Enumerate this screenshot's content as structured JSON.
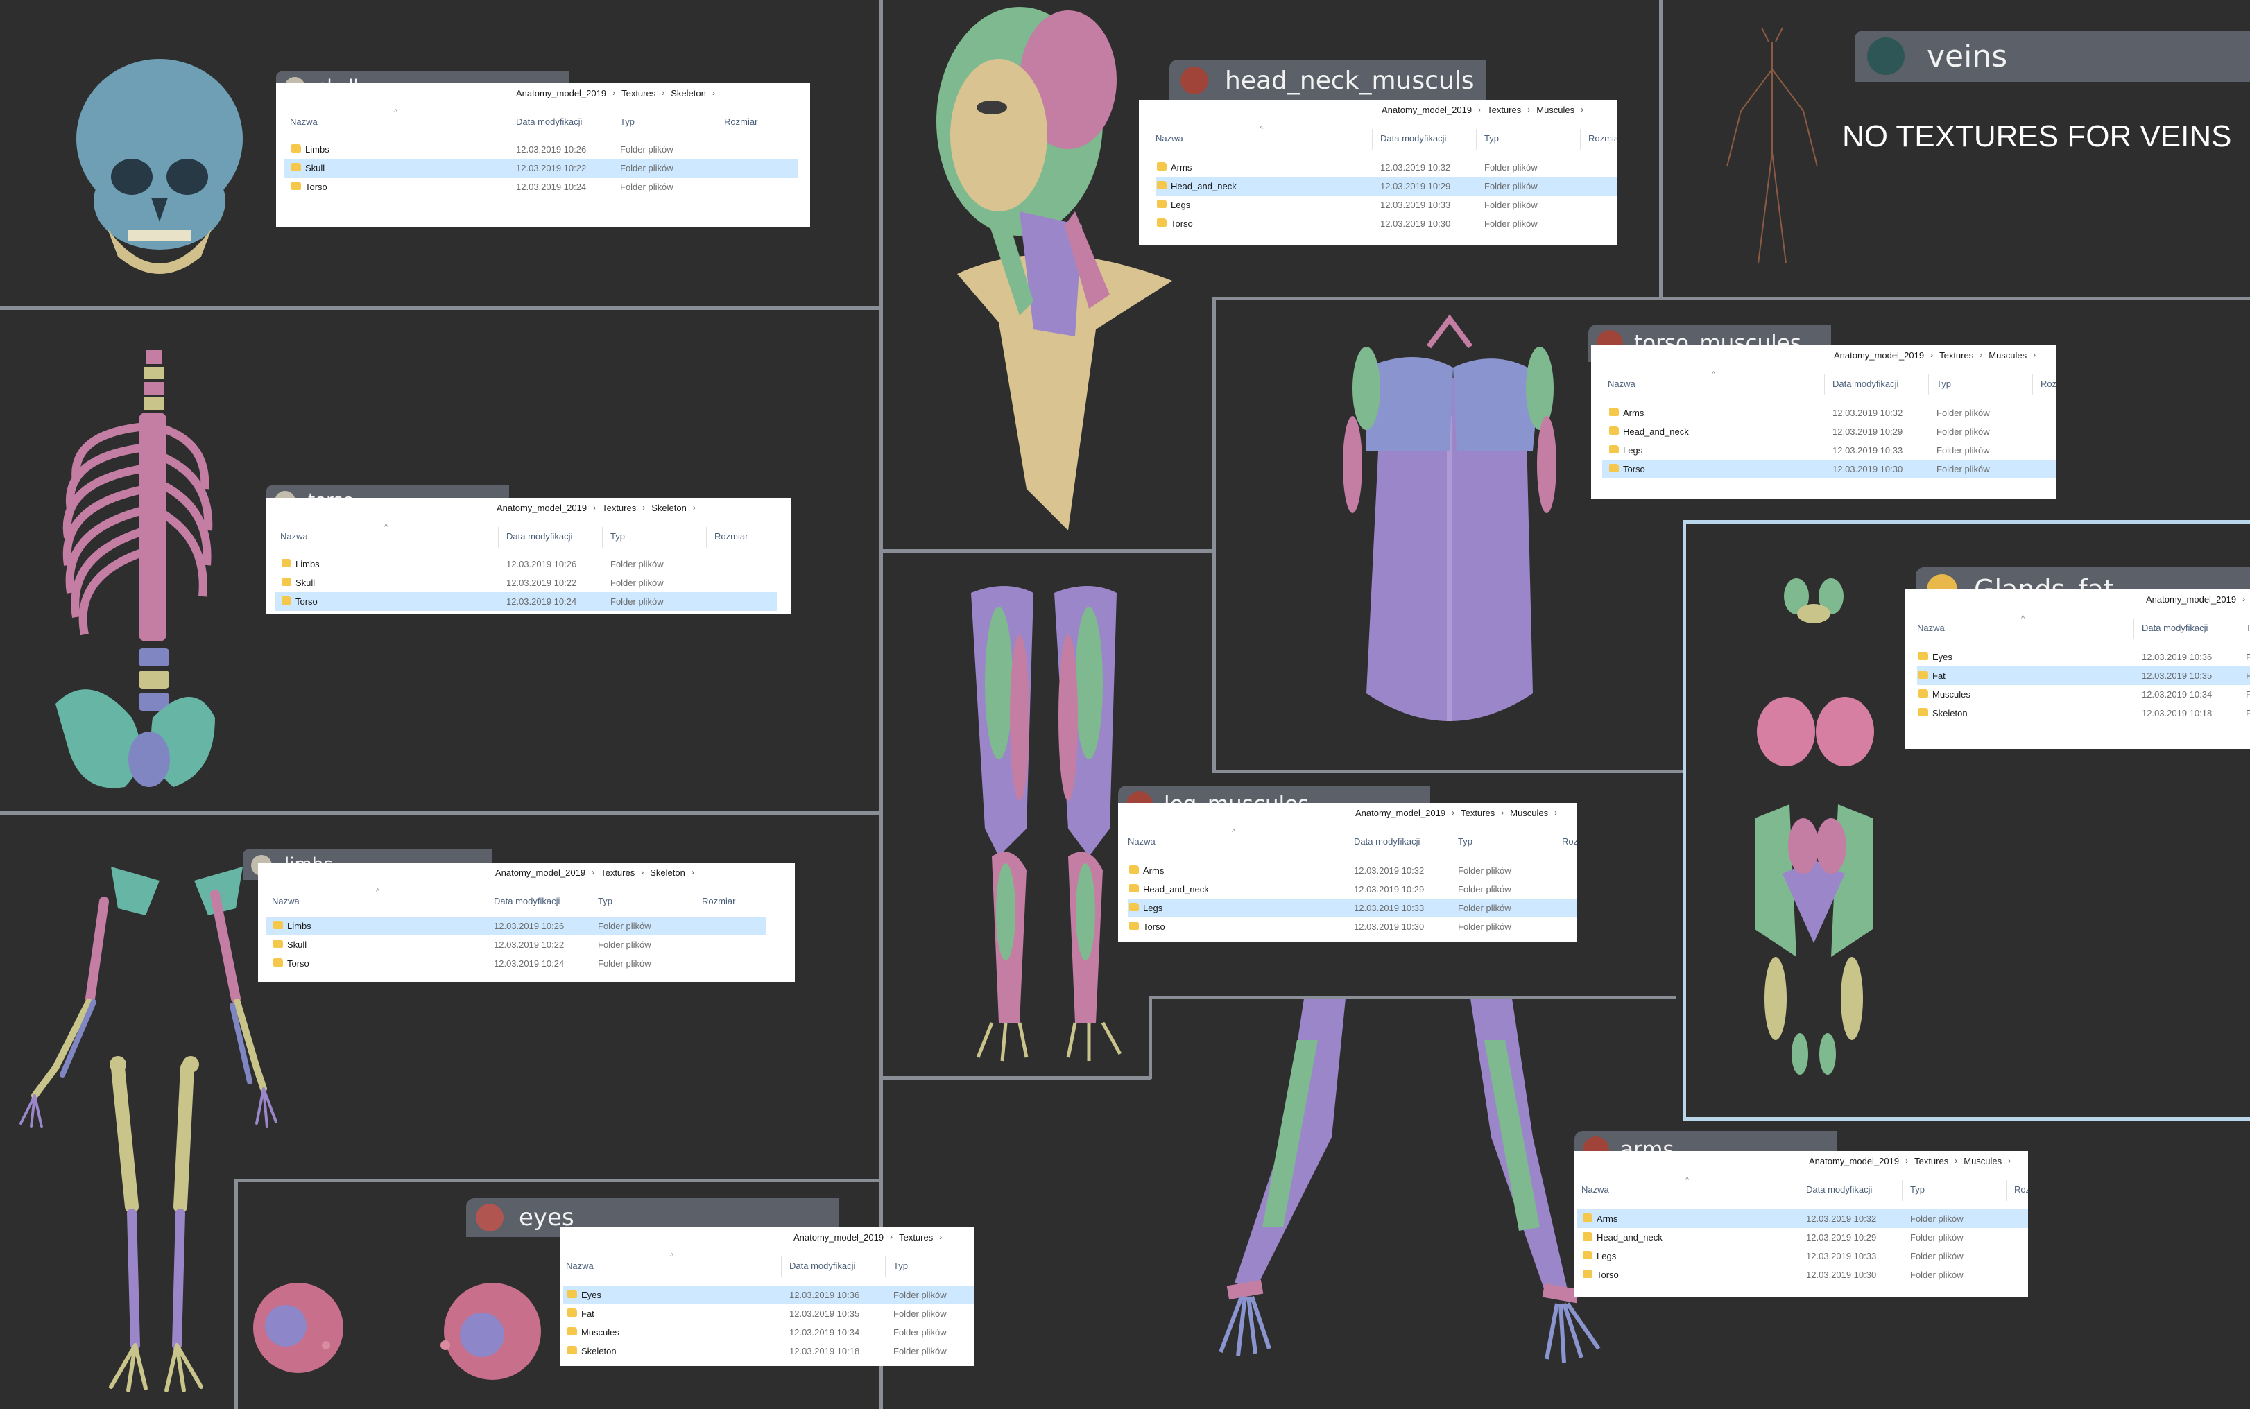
{
  "colors": {
    "background": "#2e2e2f",
    "divider": "#8a8e96",
    "selection": "#cde8ff",
    "muscle_purple": "#9b86c9",
    "muscle_green": "#7fb98f",
    "bone_yellow": "#c9c48a",
    "bone_pink": "#c47ea3",
    "skull_blue": "#6f9fb5"
  },
  "columns": {
    "name": "Nazwa",
    "date": "Data modyfikacji",
    "type": "Typ",
    "size": "Rozmiar",
    "size_cut": "Rozmiar",
    "size_short": "Roz",
    "size_tiny": "Ro"
  },
  "veins_note": "NO TEXTURES FOR VEINS",
  "panels": [
    {
      "key": "skull",
      "label": "skull",
      "swatch": "#c2bcad",
      "breadcrumb": [
        "Anatomy_model_2019",
        "Textures",
        "Skeleton"
      ],
      "rows": [
        {
          "name": "Limbs",
          "date": "12.03.2019 10:26",
          "type": "Folder plików"
        },
        {
          "name": "Skull",
          "date": "12.03.2019 10:22",
          "type": "Folder plików"
        },
        {
          "name": "Torso",
          "date": "12.03.2019 10:24",
          "type": "Folder plików"
        }
      ],
      "selected": 1
    },
    {
      "key": "torso",
      "label": "torso",
      "swatch": "#c2bcad",
      "breadcrumb": [
        "Anatomy_model_2019",
        "Textures",
        "Skeleton"
      ],
      "rows": [
        {
          "name": "Limbs",
          "date": "12.03.2019 10:26",
          "type": "Folder plików"
        },
        {
          "name": "Skull",
          "date": "12.03.2019 10:22",
          "type": "Folder plików"
        },
        {
          "name": "Torso",
          "date": "12.03.2019 10:24",
          "type": "Folder plików"
        }
      ],
      "selected": 2
    },
    {
      "key": "limbs",
      "label": "limbs",
      "swatch": "#c2bcad",
      "breadcrumb": [
        "Anatomy_model_2019",
        "Textures",
        "Skeleton"
      ],
      "rows": [
        {
          "name": "Limbs",
          "date": "12.03.2019 10:26",
          "type": "Folder plików"
        },
        {
          "name": "Skull",
          "date": "12.03.2019 10:22",
          "type": "Folder plików"
        },
        {
          "name": "Torso",
          "date": "12.03.2019 10:24",
          "type": "Folder plików"
        }
      ],
      "selected": 0
    },
    {
      "key": "eyes",
      "label": "eyes",
      "swatch": "#b0554f",
      "breadcrumb": [
        "Anatomy_model_2019",
        "Textures"
      ],
      "rows": [
        {
          "name": "Eyes",
          "date": "12.03.2019 10:36",
          "type": "Folder plików"
        },
        {
          "name": "Fat",
          "date": "12.03.2019 10:35",
          "type": "Folder plików"
        },
        {
          "name": "Muscules",
          "date": "12.03.2019 10:34",
          "type": "Folder plików"
        },
        {
          "name": "Skeleton",
          "date": "12.03.2019 10:18",
          "type": "Folder plików"
        }
      ],
      "selected": 0
    },
    {
      "key": "head_neck",
      "label": "head_neck_musculs",
      "swatch": "#a0443a",
      "breadcrumb": [
        "Anatomy_model_2019",
        "Textures",
        "Muscules"
      ],
      "rows": [
        {
          "name": "Arms",
          "date": "12.03.2019 10:32",
          "type": "Folder plików"
        },
        {
          "name": "Head_and_neck",
          "date": "12.03.2019 10:29",
          "type": "Folder plików"
        },
        {
          "name": "Legs",
          "date": "12.03.2019 10:33",
          "type": "Folder plików"
        },
        {
          "name": "Torso",
          "date": "12.03.2019 10:30",
          "type": "Folder plików"
        }
      ],
      "selected": 1
    },
    {
      "key": "torso_muscules",
      "label": "torso_muscules",
      "swatch": "#a0443a",
      "breadcrumb": [
        "Anatomy_model_2019",
        "Textures",
        "Muscules"
      ],
      "rows": [
        {
          "name": "Arms",
          "date": "12.03.2019 10:32",
          "type": "Folder plików"
        },
        {
          "name": "Head_and_neck",
          "date": "12.03.2019 10:29",
          "type": "Folder plików"
        },
        {
          "name": "Legs",
          "date": "12.03.2019 10:33",
          "type": "Folder plików"
        },
        {
          "name": "Torso",
          "date": "12.03.2019 10:30",
          "type": "Folder plików"
        }
      ],
      "selected": 3
    },
    {
      "key": "leg_muscules",
      "label": "leg_muscules",
      "swatch": "#a0443a",
      "breadcrumb": [
        "Anatomy_model_2019",
        "Textures",
        "Muscules"
      ],
      "rows": [
        {
          "name": "Arms",
          "date": "12.03.2019 10:32",
          "type": "Folder plików"
        },
        {
          "name": "Head_and_neck",
          "date": "12.03.2019 10:29",
          "type": "Folder plików"
        },
        {
          "name": "Legs",
          "date": "12.03.2019 10:33",
          "type": "Folder plików"
        },
        {
          "name": "Torso",
          "date": "12.03.2019 10:30",
          "type": "Folder plików"
        }
      ],
      "selected": 2
    },
    {
      "key": "arms",
      "label": "arms",
      "swatch": "#a0443a",
      "breadcrumb": [
        "Anatomy_model_2019",
        "Textures",
        "Muscules"
      ],
      "rows": [
        {
          "name": "Arms",
          "date": "12.03.2019 10:32",
          "type": "Folder plików"
        },
        {
          "name": "Head_and_neck",
          "date": "12.03.2019 10:29",
          "type": "Folder plików"
        },
        {
          "name": "Legs",
          "date": "12.03.2019 10:33",
          "type": "Folder plików"
        },
        {
          "name": "Torso",
          "date": "12.03.2019 10:30",
          "type": "Folder plików"
        }
      ],
      "selected": 0
    },
    {
      "key": "glands_fat",
      "label": "Glands_fat",
      "swatch": "#e8b94a",
      "breadcrumb": [
        "Anatomy_model_2019"
      ],
      "rows": [
        {
          "name": "Eyes",
          "date": "12.03.2019 10:36",
          "type": "F"
        },
        {
          "name": "Fat",
          "date": "12.03.2019 10:35",
          "type": "F"
        },
        {
          "name": "Muscules",
          "date": "12.03.2019 10:34",
          "type": "F"
        },
        {
          "name": "Skeleton",
          "date": "12.03.2019 10:18",
          "type": "F"
        }
      ],
      "selected": 1
    },
    {
      "key": "veins",
      "label": "veins",
      "swatch": "#2f5656",
      "breadcrumb": [],
      "rows": [],
      "selected": -1
    }
  ]
}
